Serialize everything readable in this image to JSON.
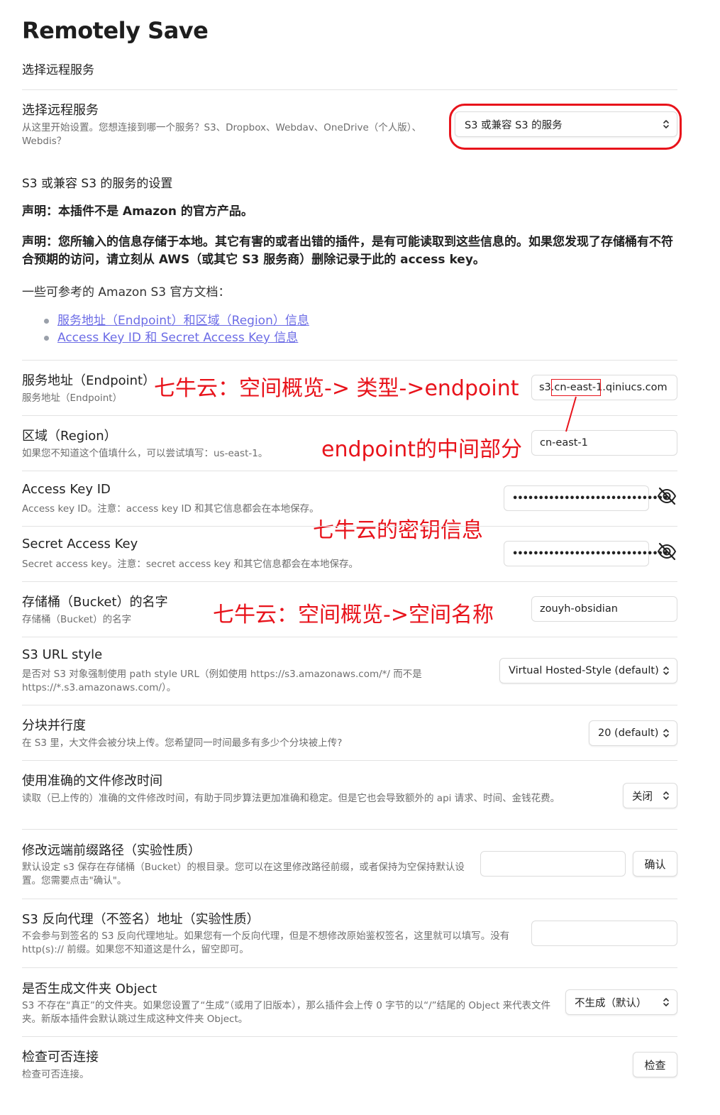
{
  "app": {
    "title": "Remotely Save",
    "subtitle": "选择远程服务"
  },
  "service": {
    "name": "选择远程服务",
    "desc": "从这里开始设置。您想连接到哪一个服务？S3、Dropbox、Webdav、OneDrive（个人版）、Webdis？",
    "selected": "S3 或兼容 S3 的服务"
  },
  "s3": {
    "section_title": "S3 或兼容 S3 的服务的设置",
    "disclaimer1": "声明：本插件不是 Amazon 的官方产品。",
    "disclaimer2": "声明：您所输入的信息存储于本地。其它有害的或者出错的插件，是有可能读取到这些信息的。如果您发现了存储桶有不符合预期的访问，请立刻从 AWS（或其它 S3 服务商）删除记录于此的 access key。",
    "docs_intro": "一些可参考的 Amazon S3 官方文档：",
    "docs_links": [
      "服务地址（Endpoint）和区域（Region）信息",
      "Access Key ID 和 Secret Access Key 信息"
    ]
  },
  "settings": {
    "endpoint": {
      "name": "服务地址（Endpoint）",
      "desc": "服务地址（Endpoint）",
      "value_prefix": "s3.",
      "value_highlight": "cn-east-1",
      "value_suffix": ".qiniucs.com"
    },
    "region": {
      "name": "区域（Region）",
      "desc": "如果您不知道这个值填什么，可以尝试填写：us-east-1。",
      "value": "cn-east-1"
    },
    "access_key": {
      "name": "Access Key ID",
      "desc": "Access key ID。注意：access key ID 和其它信息都会在本地保存。",
      "value": "••••••••••••••••••••••••••••••"
    },
    "secret_key": {
      "name": "Secret Access Key",
      "desc": "Secret access key。注意：secret access key 和其它信息都会在本地保存。",
      "value": "••••••••••••••••••••••••••••••"
    },
    "bucket": {
      "name": "存储桶（Bucket）的名字",
      "desc": "存储桶（Bucket）的名字",
      "value": "zouyh-obsidian"
    },
    "url_style": {
      "name": "S3 URL style",
      "desc": "是否对 S3 对象强制使用 path style URL（例如使用 https://s3.amazonaws.com/*/ 而不是 https://*.s3.amazonaws.com/）。",
      "selected": "Virtual Hosted-Style (default)"
    },
    "parallel": {
      "name": "分块并行度",
      "desc": "在 S3 里，大文件会被分块上传。您希望同一时间最多有多少个分块被上传?",
      "selected": "20 (default)"
    },
    "accurate_mtime": {
      "name": "使用准确的文件修改时间",
      "desc": "读取（已上传的）准确的文件修改时间，有助于同步算法更加准确和稳定。但是它也会导致额外的 api 请求、时间、金钱花费。",
      "selected": "关闭"
    },
    "prefix": {
      "name": "修改远端前缀路径（实验性质）",
      "desc": "默认设定 s3 保存在存储桶（Bucket）的根目录。您可以在这里修改路径前缀，或者保持为空保持默认设置。您需要点击\"确认\"。",
      "value": "",
      "button": "确认"
    },
    "proxy": {
      "name": "S3 反向代理（不签名）地址（实验性质）",
      "desc": "不会参与到签名的 S3 反向代理地址。如果您有一个反向代理，但是不想修改原始鉴权签名，这里就可以填写。没有 http(s):// 前缀。如果您不知道这是什么，留空即可。",
      "value": ""
    },
    "folder_object": {
      "name": "是否生成文件夹 Object",
      "desc": "S3 不存在“真正”的文件夹。如果您设置了“生成”（或用了旧版本），那么插件会上传 0 字节的以“/”结尾的 Object 来代表文件夹。新版本插件会默认跳过生成这种文件夹 Object。",
      "selected": "不生成（默认）"
    },
    "check": {
      "name": "检查可否连接",
      "desc": "检查可否连接。",
      "button": "检查"
    }
  },
  "annotations": {
    "endpoint_note": "七牛云：空间概览-> 类型->endpoint",
    "region_note": "endpoint的中间部分",
    "keys_note": "七牛云的密钥信息",
    "bucket_note": "七牛云：空间概览->空间名称"
  },
  "colors": {
    "annotation": "#e8131b",
    "link": "#6c6ce6",
    "muted": "#6e6e6e",
    "divider": "#e3e3e3"
  },
  "icons": {
    "select_caret": "updown-chevron-icon",
    "visibility": "eye-off-icon"
  }
}
